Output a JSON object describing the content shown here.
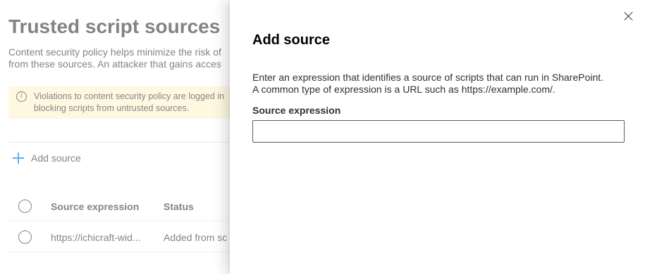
{
  "background": {
    "page_title": "Trusted script sources",
    "description_line1": "Content security policy helps minimize the risk of",
    "description_line2": "from these sources. An attacker that gains acces",
    "banner_line1": "Violations to content security policy are logged in",
    "banner_line2": "blocking scripts from untrusted sources.",
    "banner_icon": "info-icon",
    "add_source_label": "Add source",
    "table": {
      "columns": [
        "Source expression",
        "Status"
      ],
      "rows": [
        {
          "source": "https://ichicraft-wid...",
          "status": "Added from sc"
        }
      ]
    }
  },
  "panel": {
    "title": "Add source",
    "description_line1": "Enter an expression that identifies a source of scripts that can run in SharePoint.",
    "description_line2": "A common type of expression is a URL such as https://example.com/.",
    "field_label": "Source expression",
    "field_value": "",
    "field_placeholder": "",
    "close_icon": "close-icon"
  },
  "colors": {
    "accent": "#0078d4",
    "banner_bg": "#fff4ce",
    "text": "#323130"
  }
}
